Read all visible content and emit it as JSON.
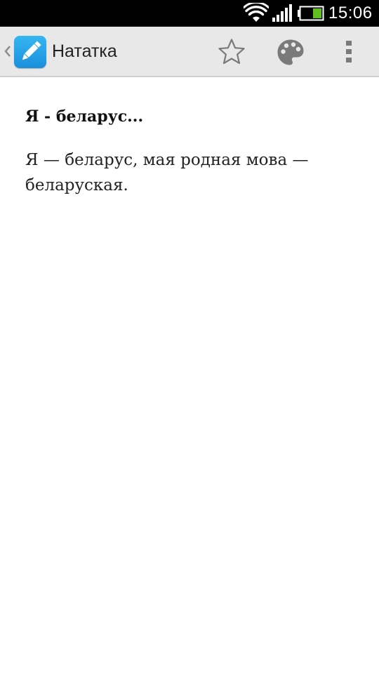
{
  "status_bar": {
    "time": "15:06",
    "icons": [
      "wifi-icon",
      "signal-icon",
      "battery-icon"
    ]
  },
  "action_bar": {
    "title": "Нататка",
    "icons": {
      "up": "chevron-left-icon",
      "app": "pencil-icon",
      "favorite": "star-icon",
      "color": "palette-icon",
      "overflow": "more-vert-icon"
    }
  },
  "note": {
    "title": "Я - беларус...",
    "body": "Я — беларус, мая родная мова — беларуская."
  },
  "colors": {
    "status_bar_bg": "#000000",
    "action_bar_bg": "#e8e8e8",
    "app_icon": "#1a8fdc",
    "battery_fill": "#5fbf1e",
    "icon_gray": "#7a7a7a"
  }
}
